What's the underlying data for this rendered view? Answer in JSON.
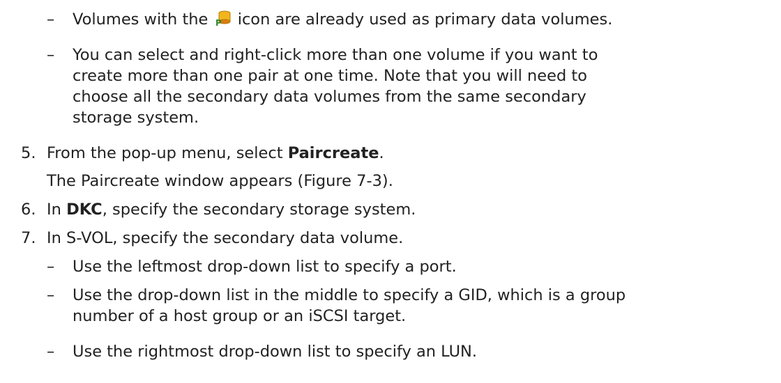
{
  "bullets_a": [
    {
      "dash": "–",
      "pre": "Volumes with the",
      "icon": "primary-volume-icon",
      "post": "icon are already used as primary data volumes."
    },
    {
      "dash": "–",
      "lines": [
        "You can select and right-click more than one volume if you want to",
        "create more than one pair at one time. Note that you will need to",
        "choose all the secondary data volumes from the same secondary",
        "storage system."
      ]
    }
  ],
  "step5": {
    "num": "5.",
    "pre": "From the pop-up menu, select ",
    "bold": "Paircreate",
    "post": ".",
    "sub": "The Paircreate window appears (Figure 7-3)."
  },
  "step6": {
    "num": "6.",
    "pre": "In ",
    "bold": "DKC",
    "post": ", specify the secondary storage system."
  },
  "step7": {
    "num": "7.",
    "text": "In S-VOL, specify the secondary data volume."
  },
  "bullets_b": [
    {
      "dash": "–",
      "lines": [
        "Use the leftmost drop-down list to specify a port."
      ]
    },
    {
      "dash": "–",
      "lines": [
        "Use the drop-down list in the middle to specify a GID, which is a group",
        "number of a host group or an iSCSI target."
      ]
    },
    {
      "dash": "–",
      "lines": [
        "Use the rightmost drop-down list to specify an LUN."
      ]
    }
  ],
  "colors": {
    "text": "#222222",
    "icon_yellow": "#f2b51d",
    "icon_orange": "#e07a10",
    "icon_green": "#2c8a2c"
  }
}
